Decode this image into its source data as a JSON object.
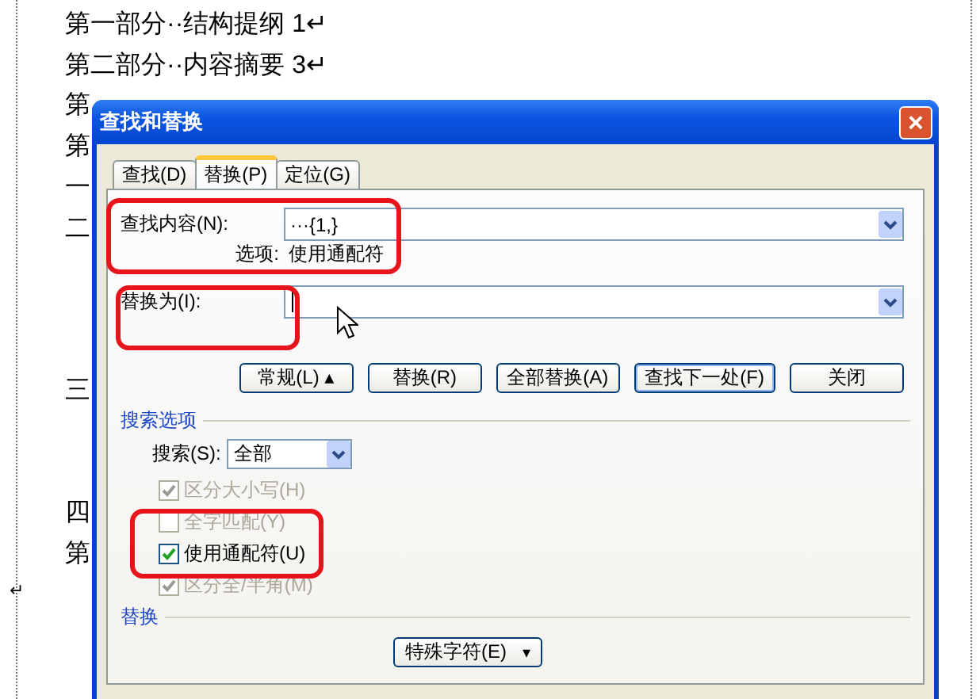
{
  "document": {
    "lines": [
      "第一部分··结构提纲 1↵",
      "第二部分··内容摘要 3↵",
      "第",
      "第",
      "一",
      "二",
      "三",
      "四",
      "第"
    ],
    "end_mark": "↵"
  },
  "dialog": {
    "title": "查找和替换",
    "close": "×",
    "tabs": [
      {
        "label": "查找(D)",
        "selected": false
      },
      {
        "label": "替换(P)",
        "selected": true
      },
      {
        "label": "定位(G)",
        "selected": false
      }
    ],
    "find": {
      "label": "查找内容(N):",
      "value": "···{1,}",
      "options_label": "选项:",
      "options_value": "使用通配符"
    },
    "replace": {
      "label": "替换为(I):"
    },
    "buttons": [
      {
        "label": "常规(L) ▴",
        "selected": false
      },
      {
        "label": "替换(R)",
        "selected": false
      },
      {
        "label": "全部替换(A)",
        "selected": false
      },
      {
        "label": "查找下一处(F)",
        "selected": true
      },
      {
        "label": "关闭",
        "selected": false
      }
    ],
    "search_options": {
      "heading": "搜索选项",
      "search_label": "搜索(S):",
      "search_value": "全部",
      "checkboxes": [
        {
          "label": "区分大小写(H)",
          "checked": true,
          "disabled": true
        },
        {
          "label": "全字匹配(Y)",
          "checked": false,
          "disabled": true
        },
        {
          "label": "使用通配符(U)",
          "checked": true,
          "disabled": false
        },
        {
          "label": "区分全/半角(M)",
          "checked": true,
          "disabled": true
        }
      ]
    },
    "replace_section": {
      "heading": "替换",
      "special_button": "特殊字符(E)",
      "special_arrow": "▾"
    }
  }
}
